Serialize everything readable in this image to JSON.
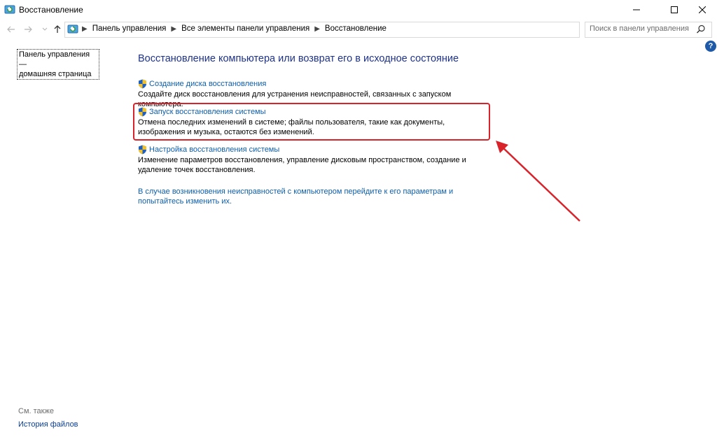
{
  "window": {
    "title": "Восстановление"
  },
  "address_bar": {
    "crumbs": [
      "Панель управления",
      "Все элементы панели управления",
      "Восстановление"
    ]
  },
  "search": {
    "placeholder": "Поиск в панели управления"
  },
  "left_pane": {
    "home_line1": "Панель управления —",
    "home_line2": "домашняя страница",
    "see_also": "См. также",
    "history": "История файлов"
  },
  "main": {
    "title": "Восстановление компьютера или возврат его в исходное состояние",
    "items": [
      {
        "label": "Создание диска восстановления",
        "description": "Создайте диск восстановления для устранения неисправностей, связанных с запуском компьютера."
      },
      {
        "label": "Запуск восстановления системы",
        "description": "Отмена последних изменений в системе; файлы пользователя, такие как документы, изображения и музыка, остаются без изменений."
      },
      {
        "label": "Настройка восстановления системы",
        "description": "Изменение параметров восстановления, управление дисковым пространством, создание и удаление точек восстановления."
      }
    ],
    "help_link": "В случае возникновения неисправностей с компьютером перейдите к его параметрам и попытайтесь изменить их."
  },
  "icons": {
    "app": "recovery-icon",
    "shield": "uac-shield-icon",
    "help": "help-icon",
    "search": "search-icon",
    "refresh": "refresh-icon"
  },
  "colors": {
    "link": "#0b5fae",
    "title": "#1e3287",
    "highlight": "#d9232b",
    "help": "#1e5aa8"
  }
}
